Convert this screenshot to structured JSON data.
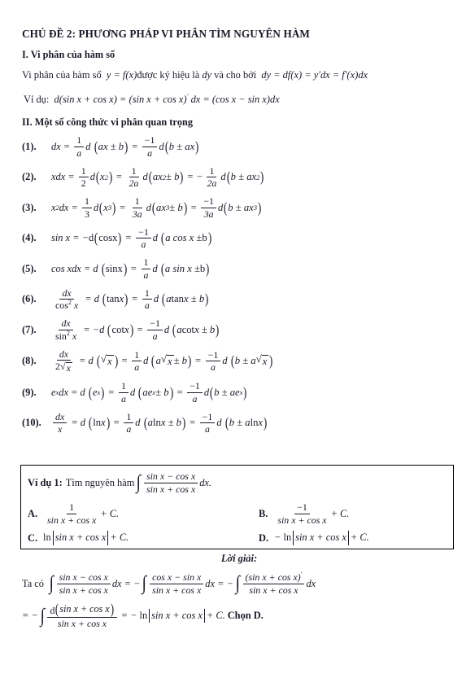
{
  "document": {
    "title": "CHỦ ĐỀ 2: PHƯƠNG PHÁP VI PHÂN TÌM NGUYÊN HÀM",
    "section1_head": "I. Vi phân của hàm số",
    "section1_text_a": "Vi phân của hàm số",
    "section1_text_b": "được ký hiệu là",
    "section1_text_c": "và cho bởi",
    "section1_formula_y": "y = f(x)",
    "section1_formula_dy": "dy",
    "section1_formula_full": "dy = df(x) = y'dx = f'(x)dx",
    "example_label": "Ví dụ:",
    "example_formula": "d(sin x + cos x) = (sin x + cos x)' dx = (cos x − sin x)dx",
    "section2_head": "II. Một số công thức vi phân quan trọng"
  },
  "formulas": [
    {
      "num": "(1).",
      "text": "dx = (1/a)d(ax ± b) = (−1/a)d(b ± ax)"
    },
    {
      "num": "(2).",
      "text": "xdx = (1/2)d(x²) = (1/2a)d(ax² ± b) = −(1/2a)d(b ± ax²)"
    },
    {
      "num": "(3).",
      "text": "x²dx = (1/3)d(x³) = (1/3a)d(ax³ ± b) = (−1/3a)d(b ± ax³)"
    },
    {
      "num": "(4).",
      "text": "sin x = −d(cosx) = (−1/a)d(a cos x ± b)"
    },
    {
      "num": "(5).",
      "text": "cos xdx = d(sinx) = (1/a)d(a sin x ± b)"
    },
    {
      "num": "(6).",
      "text": "dx/cos²x = d(tan x) = (1/a)d(a tan x ± b)"
    },
    {
      "num": "(7).",
      "text": "dx/sin²x = −d(cot x) = (−1/a)d(a cot x ± b)"
    },
    {
      "num": "(8).",
      "text": "dx/(2√x) = d(√x) = (1/a)d(a√x ± b) = (−1/a)d(b ± a√x)"
    },
    {
      "num": "(9).",
      "text": "e^x dx = d(e^x) = (1/a)d(ae^x ± b) = (−1/a)d(b ± ae^x)"
    },
    {
      "num": "(10).",
      "text": "dx/x = d(ln x) = (1/a)d(a ln x ± b) = (−1/a)d(b ± a ln x)"
    }
  ],
  "example": {
    "label": "Ví dụ 1:",
    "prompt": "Tìm nguyên hàm",
    "integrand_num": "sin x − cos x",
    "integrand_den": "sin x + cos x",
    "integrand_tail": "dx.",
    "options": [
      {
        "letter": "A.",
        "text": "1/(sin x + cos x) + C."
      },
      {
        "letter": "B.",
        "text": "−1/(sin x + cos x) + C."
      },
      {
        "letter": "C.",
        "text": "ln|sin x + cos x| + C."
      },
      {
        "letter": "D.",
        "text": "− ln|sin x + cos x| + C."
      }
    ]
  },
  "solution": {
    "heading": "Lời giải:",
    "prefix": "Ta có",
    "line1": "∫ (sin x − cos x)/(sin x + cos x) dx = −∫ (cos x − sin x)/(sin x + cos x) dx = −∫ (sin x + cos x)'/(sin x + cos x) dx",
    "line2": "= −∫ d(sin x + cos x)/(sin x + cos x) = − ln|sin x + cos x| + C.",
    "choose": "Chọn D."
  },
  "fractions": {
    "one": "1",
    "minus_one": "−1",
    "a": "a",
    "two": "2",
    "two_a": "2a",
    "three": "3",
    "three_a": "3a"
  },
  "colors": {
    "text": "#1a1a28",
    "background": "#ffffff",
    "box_border": "#000000"
  }
}
